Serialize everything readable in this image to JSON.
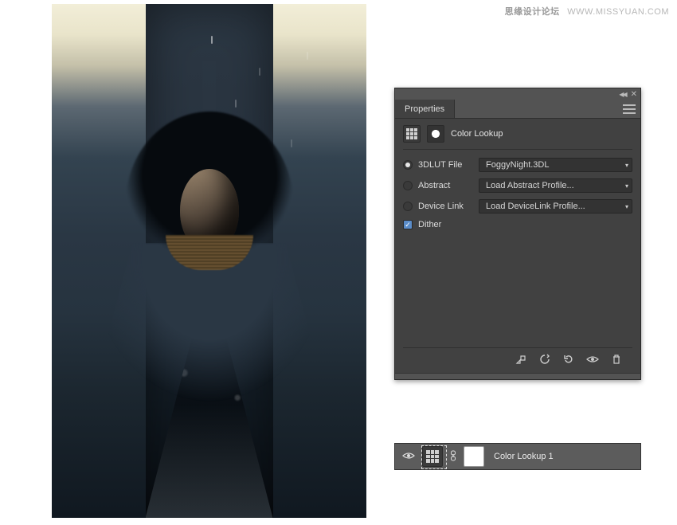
{
  "watermark": {
    "bold": "思缘设计论坛",
    "url": "WWW.MISSYUAN.COM"
  },
  "panel": {
    "title": "Properties",
    "header": "Color Lookup",
    "rows": {
      "lut": {
        "label": "3DLUT File",
        "value": "FoggyNight.3DL",
        "selected": true
      },
      "abstract": {
        "label": "Abstract",
        "value": "Load Abstract Profile...",
        "selected": false
      },
      "devicelink": {
        "label": "Device Link",
        "value": "Load DeviceLink Profile...",
        "selected": false
      }
    },
    "dither": {
      "label": "Dither",
      "checked": true
    }
  },
  "footer_icons": {
    "clip": "clip-to-layer",
    "view": "view-previous-state",
    "reset": "reset-to-default",
    "visibility": "toggle-visibility",
    "trash": "delete-adjustment"
  },
  "layer": {
    "visible": true,
    "name": "Color Lookup 1"
  }
}
